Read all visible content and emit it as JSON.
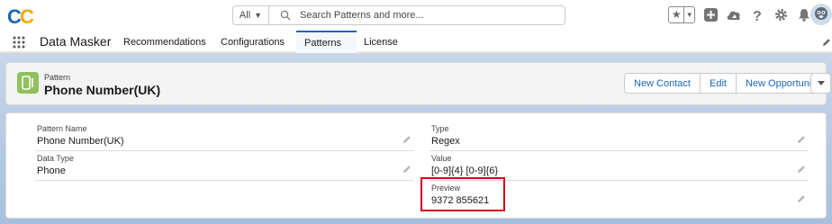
{
  "header": {
    "logo_text": "CC",
    "search_scope": "All",
    "search_placeholder": "Search Patterns and more..."
  },
  "app_nav": {
    "app_name": "Data Masker",
    "items": [
      {
        "label": "Recommendations",
        "has_dropdown": true,
        "active": false
      },
      {
        "label": "Configurations",
        "has_dropdown": true,
        "active": false
      },
      {
        "label": "Patterns",
        "has_dropdown": true,
        "active": true
      },
      {
        "label": "License",
        "has_dropdown": false,
        "active": false
      }
    ]
  },
  "record": {
    "object_label": "Pattern",
    "title": "Phone Number(UK)",
    "actions": [
      "New Contact",
      "Edit",
      "New Opportunity"
    ]
  },
  "details": {
    "left": [
      {
        "label": "Pattern Name",
        "value": "Phone Number(UK)"
      },
      {
        "label": "Data Type",
        "value": "Phone"
      }
    ],
    "right": [
      {
        "label": "Type",
        "value": "Regex"
      },
      {
        "label": "Value",
        "value": "[0-9]{4} [0-9]{6}"
      },
      {
        "label": "Preview",
        "value": "9372 855621"
      }
    ]
  },
  "colors": {
    "brand_blue": "#1b66b5",
    "record_icon": "#8fc25b",
    "highlight_box": "#d0021b"
  },
  "icons": [
    "waffle-icon",
    "search-icon",
    "favorites-star-icon",
    "add-icon",
    "trailhead-icon",
    "help-icon",
    "gear-icon",
    "bell-icon",
    "pencil-icon"
  ]
}
